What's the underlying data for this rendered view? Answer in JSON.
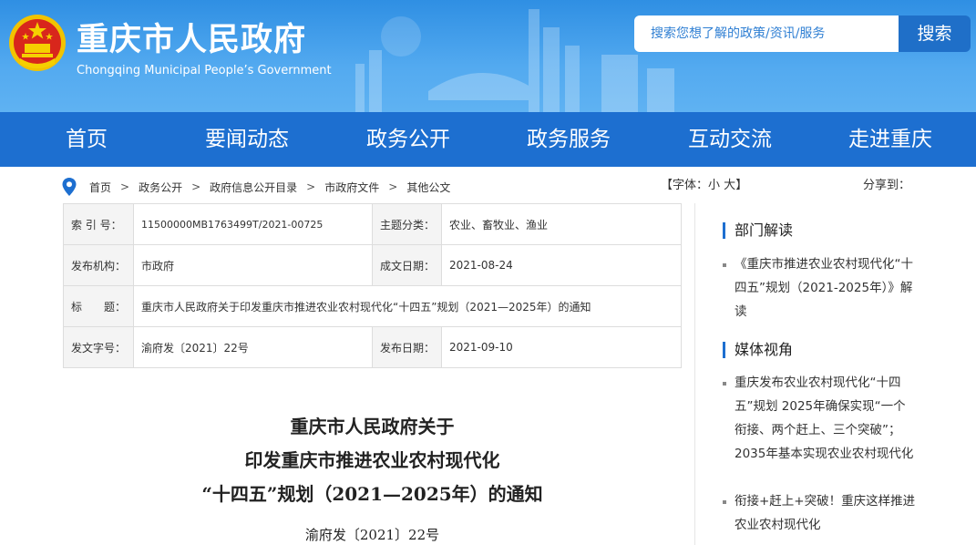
{
  "header": {
    "title": "重庆市人民政府",
    "subtitle": "Chongqing Municipal People’s Government",
    "search_placeholder": "搜索您想了解的政策/资讯/服务",
    "search_button": "搜索"
  },
  "nav": [
    "首页",
    "要闻动态",
    "政务公开",
    "政务服务",
    "互动交流",
    "走进重庆"
  ],
  "breadcrumb": [
    "首页",
    "政务公开",
    "政府信息公开目录",
    "市政府文件",
    "其他公文"
  ],
  "breadcrumb_sep": ">",
  "font_control": {
    "prefix": "【字体：",
    "small": "小",
    "large": "大",
    "suffix": "】"
  },
  "share_label": "分享到：",
  "info": {
    "index_label": "索 引 号：",
    "index_value": "11500000MB1763499T/2021-00725",
    "topic_label": "主题分类：",
    "topic_value": "农业、畜牧业、渔业",
    "org_label": "发布机构：",
    "org_value": "市政府",
    "created_label": "成文日期：",
    "created_value": "2021-08-24",
    "title_label": "标　　题：",
    "title_value": "重庆市人民政府关于印发重庆市推进农业农村现代化“十四五”规划（2021—2025年）的通知",
    "docno_label": "发文字号：",
    "docno_value": "渝府发〔2021〕22号",
    "published_label": "发布日期：",
    "published_value": "2021-09-10"
  },
  "document": {
    "title_lines": [
      "重庆市人民政府关于",
      "印发重庆市推进农业农村现代化",
      "“十四五”规划（2021—2025年）的通知"
    ],
    "number": "渝府发〔2021〕22号"
  },
  "sidebar": {
    "section1_title": "部门解读",
    "section1_items": [
      "《重庆市推进农业农村现代化“十四五”规划（2021-2025年）》解读"
    ],
    "section2_title": "媒体视角",
    "section2_items": [
      "重庆发布农业农村现代化“十四五”规划 2025年确保实现“一个衔接、两个赶上、三个突破”；2035年基本实现农业农村现代化",
      "衔接+赶上+突破！重庆这样推进农业农村现代化"
    ]
  },
  "colors": {
    "header_blue": "#3d9be9",
    "nav_blue": "#1d6fd0",
    "accent": "#1f6fc8"
  }
}
